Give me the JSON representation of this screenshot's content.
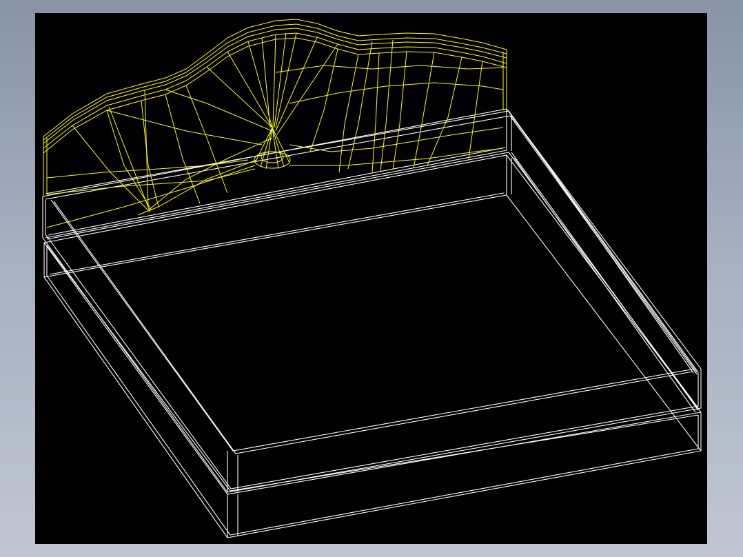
{
  "viewer": {
    "background_color": "#000000",
    "frame_color": "#9aa3b6"
  },
  "model": {
    "object": "bed-wireframe",
    "render_mode": "wireframe",
    "parts": [
      {
        "name": "headboard",
        "line_color": "#ffff00"
      },
      {
        "name": "mattress",
        "line_color": "#ffffff"
      },
      {
        "name": "base",
        "line_color": "#ffffff"
      }
    ]
  }
}
